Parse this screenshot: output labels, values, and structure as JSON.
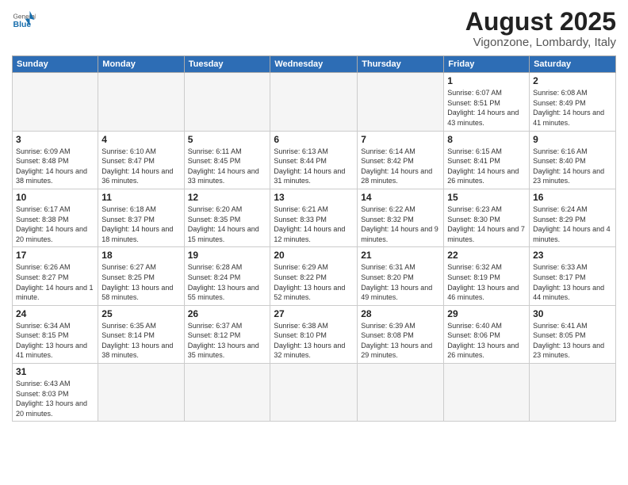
{
  "header": {
    "logo": {
      "general": "General",
      "blue": "Blue"
    },
    "title": "August 2025",
    "subtitle": "Vigonzone, Lombardy, Italy"
  },
  "weekdays": [
    "Sunday",
    "Monday",
    "Tuesday",
    "Wednesday",
    "Thursday",
    "Friday",
    "Saturday"
  ],
  "weeks": [
    [
      {
        "day": "",
        "info": ""
      },
      {
        "day": "",
        "info": ""
      },
      {
        "day": "",
        "info": ""
      },
      {
        "day": "",
        "info": ""
      },
      {
        "day": "",
        "info": ""
      },
      {
        "day": "1",
        "info": "Sunrise: 6:07 AM\nSunset: 8:51 PM\nDaylight: 14 hours and 43 minutes."
      },
      {
        "day": "2",
        "info": "Sunrise: 6:08 AM\nSunset: 8:49 PM\nDaylight: 14 hours and 41 minutes."
      }
    ],
    [
      {
        "day": "3",
        "info": "Sunrise: 6:09 AM\nSunset: 8:48 PM\nDaylight: 14 hours and 38 minutes."
      },
      {
        "day": "4",
        "info": "Sunrise: 6:10 AM\nSunset: 8:47 PM\nDaylight: 14 hours and 36 minutes."
      },
      {
        "day": "5",
        "info": "Sunrise: 6:11 AM\nSunset: 8:45 PM\nDaylight: 14 hours and 33 minutes."
      },
      {
        "day": "6",
        "info": "Sunrise: 6:13 AM\nSunset: 8:44 PM\nDaylight: 14 hours and 31 minutes."
      },
      {
        "day": "7",
        "info": "Sunrise: 6:14 AM\nSunset: 8:42 PM\nDaylight: 14 hours and 28 minutes."
      },
      {
        "day": "8",
        "info": "Sunrise: 6:15 AM\nSunset: 8:41 PM\nDaylight: 14 hours and 26 minutes."
      },
      {
        "day": "9",
        "info": "Sunrise: 6:16 AM\nSunset: 8:40 PM\nDaylight: 14 hours and 23 minutes."
      }
    ],
    [
      {
        "day": "10",
        "info": "Sunrise: 6:17 AM\nSunset: 8:38 PM\nDaylight: 14 hours and 20 minutes."
      },
      {
        "day": "11",
        "info": "Sunrise: 6:18 AM\nSunset: 8:37 PM\nDaylight: 14 hours and 18 minutes."
      },
      {
        "day": "12",
        "info": "Sunrise: 6:20 AM\nSunset: 8:35 PM\nDaylight: 14 hours and 15 minutes."
      },
      {
        "day": "13",
        "info": "Sunrise: 6:21 AM\nSunset: 8:33 PM\nDaylight: 14 hours and 12 minutes."
      },
      {
        "day": "14",
        "info": "Sunrise: 6:22 AM\nSunset: 8:32 PM\nDaylight: 14 hours and 9 minutes."
      },
      {
        "day": "15",
        "info": "Sunrise: 6:23 AM\nSunset: 8:30 PM\nDaylight: 14 hours and 7 minutes."
      },
      {
        "day": "16",
        "info": "Sunrise: 6:24 AM\nSunset: 8:29 PM\nDaylight: 14 hours and 4 minutes."
      }
    ],
    [
      {
        "day": "17",
        "info": "Sunrise: 6:26 AM\nSunset: 8:27 PM\nDaylight: 14 hours and 1 minute."
      },
      {
        "day": "18",
        "info": "Sunrise: 6:27 AM\nSunset: 8:25 PM\nDaylight: 13 hours and 58 minutes."
      },
      {
        "day": "19",
        "info": "Sunrise: 6:28 AM\nSunset: 8:24 PM\nDaylight: 13 hours and 55 minutes."
      },
      {
        "day": "20",
        "info": "Sunrise: 6:29 AM\nSunset: 8:22 PM\nDaylight: 13 hours and 52 minutes."
      },
      {
        "day": "21",
        "info": "Sunrise: 6:31 AM\nSunset: 8:20 PM\nDaylight: 13 hours and 49 minutes."
      },
      {
        "day": "22",
        "info": "Sunrise: 6:32 AM\nSunset: 8:19 PM\nDaylight: 13 hours and 46 minutes."
      },
      {
        "day": "23",
        "info": "Sunrise: 6:33 AM\nSunset: 8:17 PM\nDaylight: 13 hours and 44 minutes."
      }
    ],
    [
      {
        "day": "24",
        "info": "Sunrise: 6:34 AM\nSunset: 8:15 PM\nDaylight: 13 hours and 41 minutes."
      },
      {
        "day": "25",
        "info": "Sunrise: 6:35 AM\nSunset: 8:14 PM\nDaylight: 13 hours and 38 minutes."
      },
      {
        "day": "26",
        "info": "Sunrise: 6:37 AM\nSunset: 8:12 PM\nDaylight: 13 hours and 35 minutes."
      },
      {
        "day": "27",
        "info": "Sunrise: 6:38 AM\nSunset: 8:10 PM\nDaylight: 13 hours and 32 minutes."
      },
      {
        "day": "28",
        "info": "Sunrise: 6:39 AM\nSunset: 8:08 PM\nDaylight: 13 hours and 29 minutes."
      },
      {
        "day": "29",
        "info": "Sunrise: 6:40 AM\nSunset: 8:06 PM\nDaylight: 13 hours and 26 minutes."
      },
      {
        "day": "30",
        "info": "Sunrise: 6:41 AM\nSunset: 8:05 PM\nDaylight: 13 hours and 23 minutes."
      }
    ],
    [
      {
        "day": "31",
        "info": "Sunrise: 6:43 AM\nSunset: 8:03 PM\nDaylight: 13 hours and 20 minutes."
      },
      {
        "day": "",
        "info": ""
      },
      {
        "day": "",
        "info": ""
      },
      {
        "day": "",
        "info": ""
      },
      {
        "day": "",
        "info": ""
      },
      {
        "day": "",
        "info": ""
      },
      {
        "day": "",
        "info": ""
      }
    ]
  ]
}
